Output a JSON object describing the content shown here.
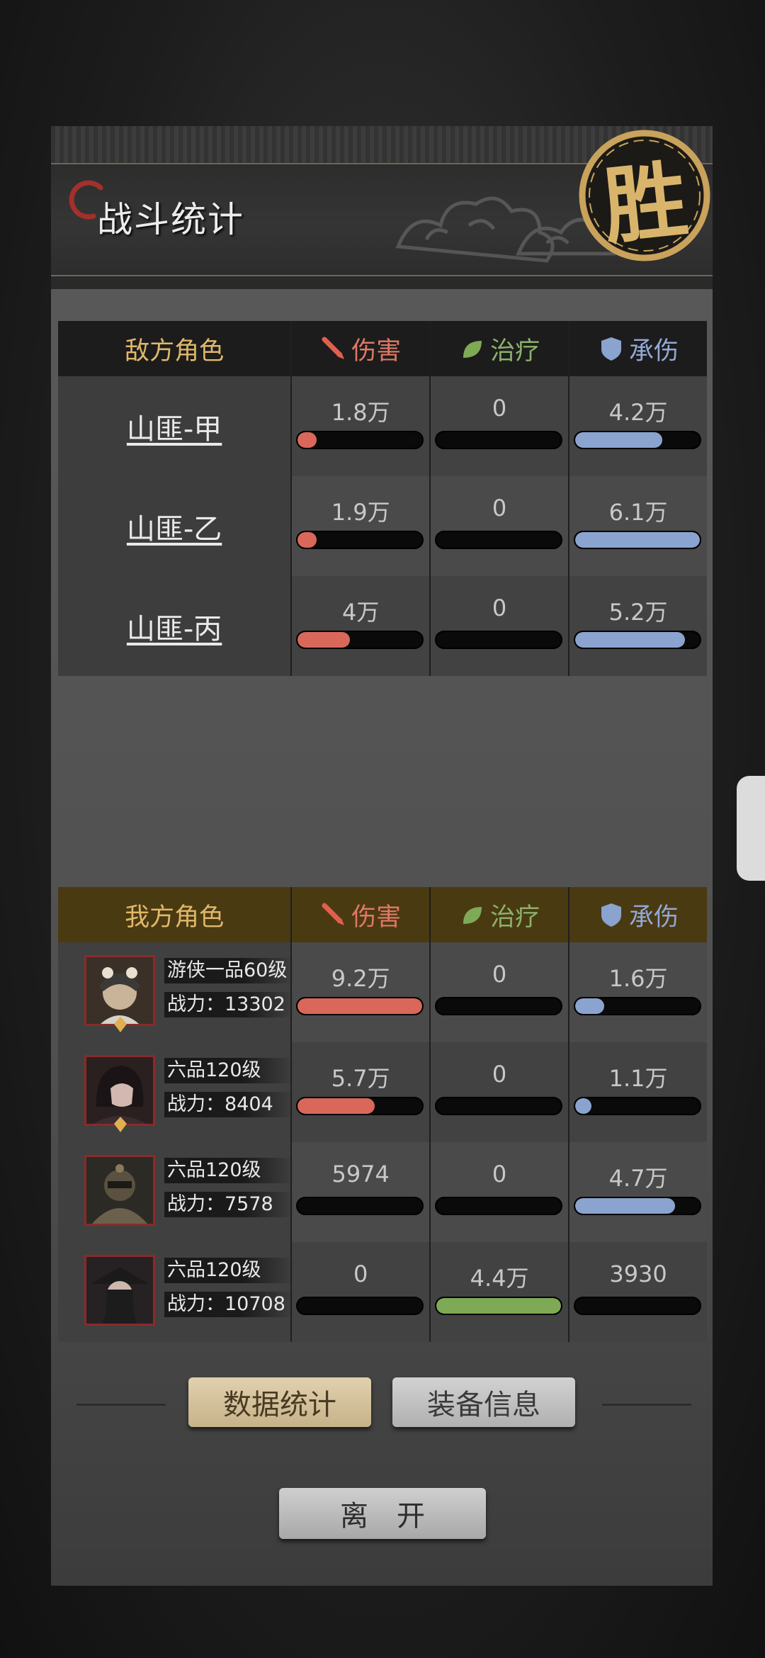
{
  "header": {
    "title": "战斗统计",
    "victory_seal": "胜"
  },
  "columns": {
    "damage": "伤害",
    "heal": "治疗",
    "tank": "承伤"
  },
  "enemy": {
    "section_label": "敌方角色",
    "rows": [
      {
        "name": "山匪-甲",
        "damage": "1.8万",
        "damage_fill": 0.15,
        "heal": "0",
        "heal_fill": 0,
        "tank": "4.2万",
        "tank_fill": 0.7
      },
      {
        "name": "山匪-乙",
        "damage": "1.9万",
        "damage_fill": 0.15,
        "heal": "0",
        "heal_fill": 0,
        "tank": "6.1万",
        "tank_fill": 1.0
      },
      {
        "name": "山匪-丙",
        "damage": "4万",
        "damage_fill": 0.42,
        "heal": "0",
        "heal_fill": 0,
        "tank": "5.2万",
        "tank_fill": 0.88
      }
    ]
  },
  "ally": {
    "section_label": "我方角色",
    "rows": [
      {
        "title": "游侠一品60级",
        "power": "战力：13302",
        "damage": "9.2万",
        "damage_fill": 1.0,
        "heal": "0",
        "heal_fill": 0,
        "tank": "1.6万",
        "tank_fill": 0.23
      },
      {
        "title": "六品120级",
        "power": "战力：8404",
        "damage": "5.7万",
        "damage_fill": 0.62,
        "heal": "0",
        "heal_fill": 0,
        "tank": "1.1万",
        "tank_fill": 0.13
      },
      {
        "title": "六品120级",
        "power": "战力：7578",
        "damage": "5974",
        "damage_fill": 0,
        "heal": "0",
        "heal_fill": 0,
        "tank": "4.7万",
        "tank_fill": 0.8
      },
      {
        "title": "六品120级",
        "power": "战力：10708",
        "damage": "0",
        "damage_fill": 0,
        "heal": "4.4万",
        "heal_fill": 1.0,
        "tank": "3930",
        "tank_fill": 0
      }
    ]
  },
  "buttons": {
    "stats": "数据统计",
    "equip": "装备信息",
    "leave": "离开"
  },
  "colors": {
    "damage": "#d9685a",
    "heal": "#7eaa56",
    "tank": "#8aa3cf",
    "enemy_header": "#1c1c1c",
    "ally_header": "#4a3a12",
    "gold": "#e0b86a"
  }
}
